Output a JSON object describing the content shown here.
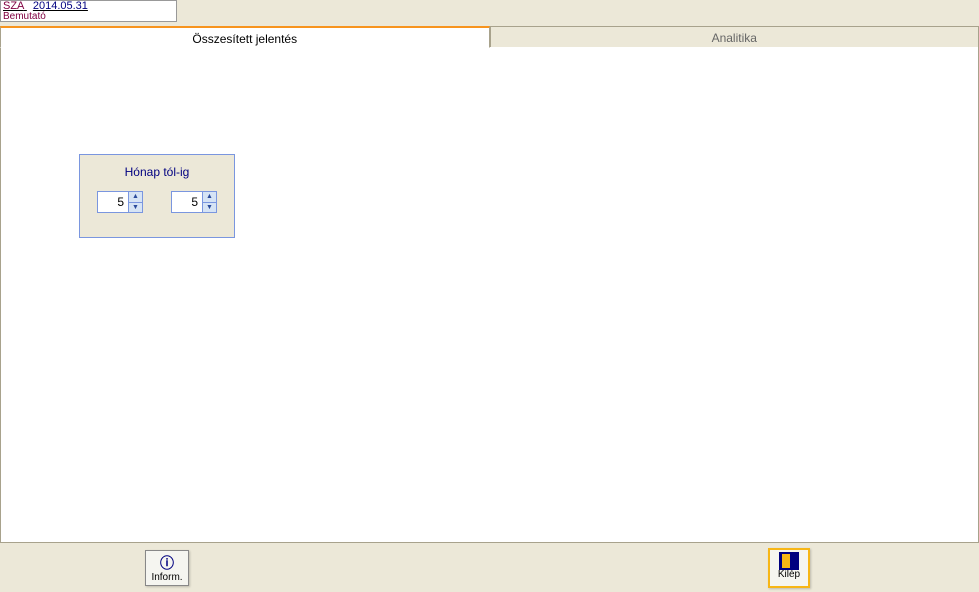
{
  "header": {
    "code": "SZA",
    "date": "2014.05.31",
    "subtitle": "Bemutató"
  },
  "tabs": {
    "summary": "Összesített jelentés",
    "analytics": "Analitika"
  },
  "monthBox": {
    "title": "Hónap tól-ig",
    "from": "5",
    "to": "5"
  },
  "buttons": {
    "inform": "Inform.",
    "kilep": "Kilép"
  }
}
